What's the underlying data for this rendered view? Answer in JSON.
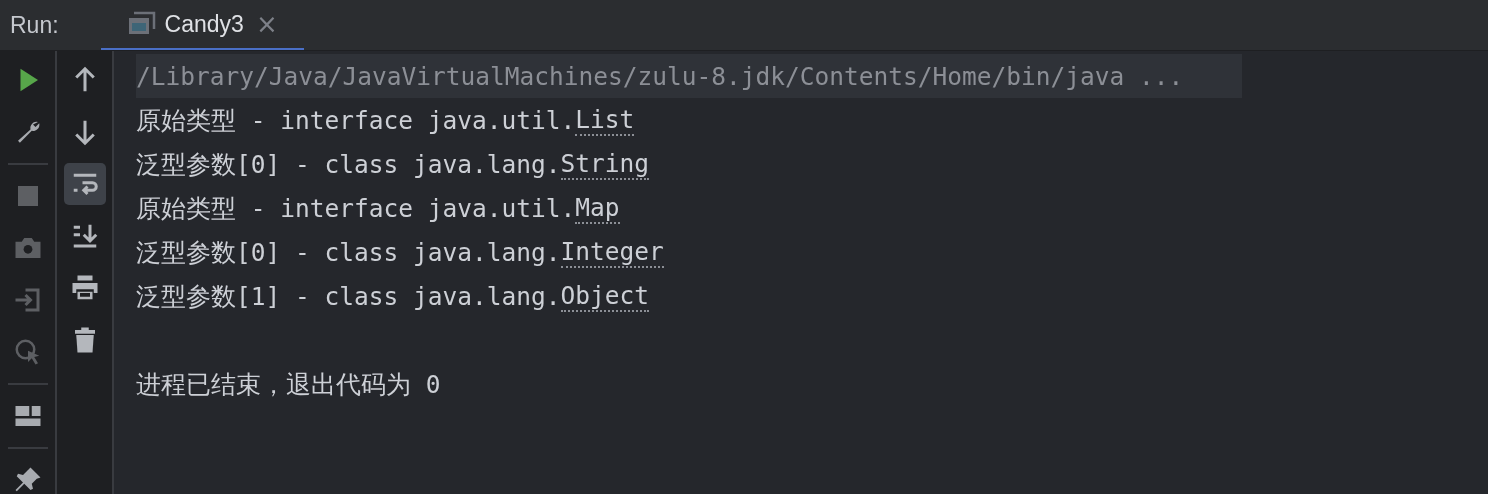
{
  "header": {
    "label": "Run:",
    "tabs": [
      {
        "title": "Candy3",
        "close": "×",
        "selected": true
      }
    ]
  },
  "left_toolbar": [
    {
      "kind": "run",
      "disabled": false
    },
    {
      "kind": "wrench",
      "disabled": false
    },
    {
      "kind": "separator"
    },
    {
      "kind": "stop",
      "disabled": true
    },
    {
      "kind": "camera",
      "disabled": true
    },
    {
      "kind": "login",
      "disabled": true
    },
    {
      "kind": "clock",
      "disabled": true
    },
    {
      "kind": "separator"
    },
    {
      "kind": "layout",
      "disabled": false
    },
    {
      "kind": "separator"
    },
    {
      "kind": "pin",
      "disabled": false
    }
  ],
  "console_toolbar": [
    {
      "kind": "up",
      "selected": false
    },
    {
      "kind": "down",
      "selected": false
    },
    {
      "kind": "wrap",
      "selected": true
    },
    {
      "kind": "scroll-end",
      "selected": false
    },
    {
      "kind": "print",
      "selected": false
    },
    {
      "kind": "trash",
      "selected": false
    }
  ],
  "console": [
    {
      "kind": "command",
      "text": "/Library/Java/JavaVirtualMachines/zulu-8.jdk/Contents/Home/bin/java ..."
    },
    {
      "kind": "output",
      "text": "原始类型 - interface java.util.",
      "link": "List"
    },
    {
      "kind": "output",
      "text": "泛型参数[0] - class java.lang.",
      "link": "String"
    },
    {
      "kind": "output",
      "text": "原始类型 - interface java.util.",
      "link": "Map"
    },
    {
      "kind": "output",
      "text": "泛型参数[0] - class java.lang.",
      "link": "Integer"
    },
    {
      "kind": "output",
      "text": "泛型参数[1] - class java.lang.",
      "link": "Object"
    },
    {
      "kind": "blank"
    },
    {
      "kind": "output",
      "text": "进程已结束，退出代码为 0"
    }
  ]
}
